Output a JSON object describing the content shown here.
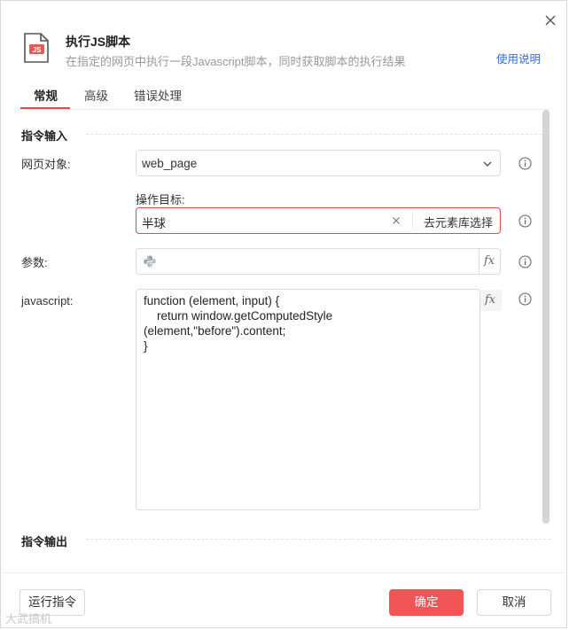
{
  "header": {
    "title": "执行JS脚本",
    "subtitle": "在指定的网页中执行一段Javascript脚本，同时获取脚本的执行结果",
    "help_link": "使用说明",
    "file_icon_text": "JS"
  },
  "tabs": [
    {
      "label": "常规",
      "active": true
    },
    {
      "label": "高级",
      "active": false
    },
    {
      "label": "错误处理",
      "active": false
    }
  ],
  "input_section": {
    "title": "指令输入",
    "web_page": {
      "label": "网页对象:",
      "value": "web_page"
    },
    "target": {
      "label": "操作目标:",
      "value": "半球",
      "pick_button": "去元素库选择"
    },
    "params": {
      "label": "参数:",
      "value": "",
      "fx_label": "fx"
    },
    "javascript": {
      "label": "javascript:",
      "fx_label": "fx",
      "code_lines": [
        "function (element, input) {",
        "    return window.getComputedStyle",
        "(element,\"before\").content;",
        "}"
      ]
    }
  },
  "output_section": {
    "title": "指令输出"
  },
  "footer": {
    "run_button": "运行指令",
    "ok_button": "确定",
    "cancel_button": "取消"
  },
  "watermark": "大武搞机",
  "colors": {
    "accent": "#e84a4a",
    "primary_button": "#f25555",
    "link": "#2b6fd6",
    "icon_red": "#e05a5a"
  }
}
